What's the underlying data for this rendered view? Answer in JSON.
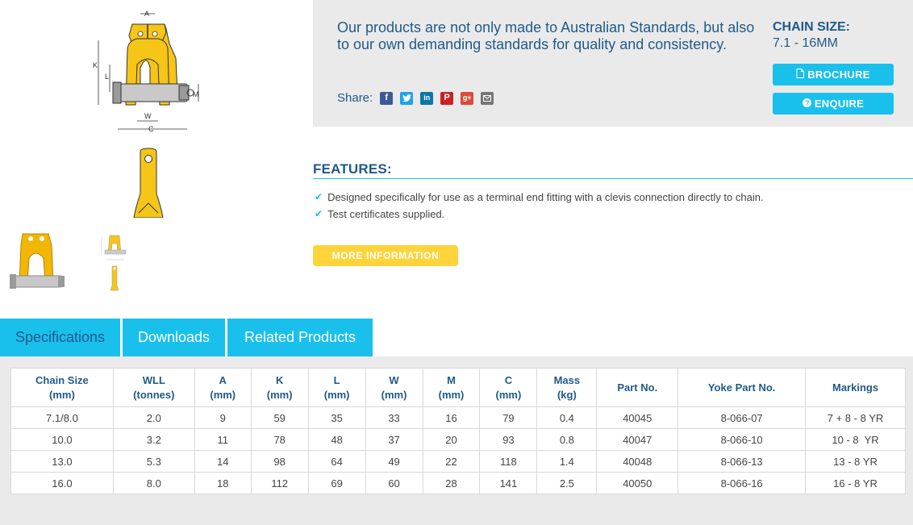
{
  "product_info": {
    "tagline": "Our products are not only made to Australian Standards, but also to our own demanding standards for quality and consistency.",
    "share_label": "Share:",
    "share_icons": [
      "facebook-icon",
      "twitter-icon",
      "linkedin-icon",
      "pinterest-icon",
      "google-plus-icon",
      "email-icon"
    ],
    "chain_size_label": "CHAIN SIZE:",
    "chain_size_value": "7.1 - 16MM",
    "brochure_label": "BROCHURE",
    "enquire_label": "ENQUIRE"
  },
  "diagram_labels": {
    "a": "A",
    "k": "K",
    "l": "L",
    "m": "M",
    "w": "W",
    "c": "C"
  },
  "features": {
    "title": "FEATURES:",
    "items": [
      "Designed specifically for use as a terminal end fitting with a clevis connection directly to chain.",
      "Test certificates supplied."
    ],
    "more_info_label": "MORE INFORMATION"
  },
  "tabs": [
    {
      "label": "Specifications",
      "active": true
    },
    {
      "label": "Downloads",
      "active": false
    },
    {
      "label": "Related Products",
      "active": false
    }
  ],
  "spec_table": {
    "headers": [
      [
        "Chain Size",
        "(mm)"
      ],
      [
        "WLL",
        "(tonnes)"
      ],
      [
        "A",
        "(mm)"
      ],
      [
        "K",
        "(mm)"
      ],
      [
        "L",
        "(mm)"
      ],
      [
        "W",
        "(mm)"
      ],
      [
        "M",
        "(mm)"
      ],
      [
        "C",
        "(mm)"
      ],
      [
        "Mass",
        "(kg)"
      ],
      [
        "Part No.",
        ""
      ],
      [
        "Yoke Part No.",
        ""
      ],
      [
        "Markings",
        ""
      ]
    ],
    "rows": [
      [
        "7.1/8.0",
        "2.0",
        "9",
        "59",
        "35",
        "33",
        "16",
        "79",
        "0.4",
        "40045",
        "8-066-07",
        "7 + 8 - 8 YR"
      ],
      [
        "10.0",
        "3.2",
        "11",
        "78",
        "48",
        "37",
        "20",
        "93",
        "0.8",
        "40047",
        "8-066-10",
        "10 - 8  YR"
      ],
      [
        "13.0",
        "5.3",
        "14",
        "98",
        "64",
        "49",
        "22",
        "118",
        "1.4",
        "40048",
        "8-066-13",
        "13 - 8 YR"
      ],
      [
        "16.0",
        "8.0",
        "18",
        "112",
        "69",
        "60",
        "28",
        "141",
        "2.5",
        "40050",
        "8-066-16",
        "16 - 8 YR"
      ]
    ]
  },
  "colors": {
    "accent": "#19c0ec",
    "heading": "#1f5a8a",
    "yellow": "#ffd33a",
    "panel": "#eaeaea"
  }
}
